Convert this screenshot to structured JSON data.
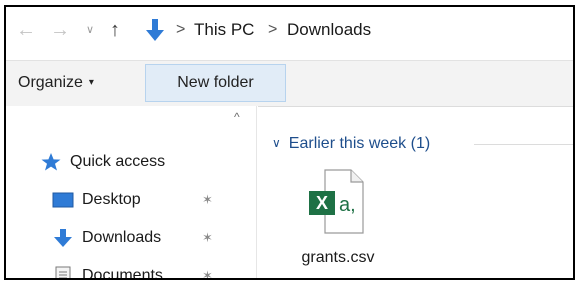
{
  "address_bar": {
    "back_icon": "arrow-left-icon",
    "forward_icon": "arrow-right-icon",
    "recent_icon": "chevron-down-icon",
    "up_icon": "arrow-up-icon",
    "location_icon": "downloads-arrow-icon",
    "separator": ">",
    "breadcrumb": [
      "This PC",
      "Downloads"
    ]
  },
  "toolbar": {
    "organize_label": "Organize",
    "organize_caret": "▾",
    "new_folder_label": "New folder"
  },
  "nav_pane": {
    "quick_access_label": "Quick access",
    "items": [
      {
        "label": "Desktop",
        "icon": "desktop-icon",
        "pinned": true
      },
      {
        "label": "Downloads",
        "icon": "downloads-icon",
        "pinned": true
      },
      {
        "label": "Documents",
        "icon": "documents-icon",
        "pinned": true
      }
    ]
  },
  "content": {
    "group_header": "Earlier this week (1)",
    "files": [
      {
        "name": "grants.csv",
        "icon": "excel-csv-icon"
      }
    ]
  },
  "colors": {
    "accent": "#1e4e8c",
    "selection": "#e1ecf7",
    "excel_green": "#1e7145",
    "downloads_blue": "#2f7bd6"
  }
}
